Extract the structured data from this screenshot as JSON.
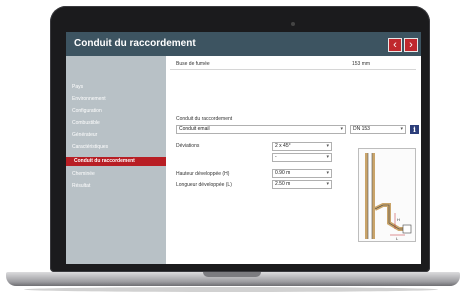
{
  "window": {
    "title": "Conduit du raccordement",
    "prev_label": "‹",
    "next_label": "›"
  },
  "sidebar": {
    "items": [
      {
        "label": "Pays"
      },
      {
        "label": "Environnement"
      },
      {
        "label": "Configuration"
      },
      {
        "label": "Combustible"
      },
      {
        "label": "Générateur"
      },
      {
        "label": "Caractéristiques"
      },
      {
        "label": "Conduit du raccordement",
        "active": true
      },
      {
        "label": "Cheminée"
      },
      {
        "label": "Résultat"
      }
    ]
  },
  "main": {
    "buse": {
      "label": "Buse de fumée",
      "value": "153 mm"
    },
    "conduit": {
      "section_label": "Conduit du raccordement",
      "type_value": "Conduit email",
      "size_value": "DN 153"
    },
    "deviations": {
      "label": "Déviations",
      "value1": "2 x 45°",
      "value2": "-"
    },
    "hauteur": {
      "label": "Hauteur développée (H)",
      "value": "0.90 m"
    },
    "longueur": {
      "label": "Longueur développée (L)",
      "value": "2.50 m"
    },
    "diagram": {
      "h_label": "H",
      "l_label": "L"
    }
  },
  "icons": {
    "info": "info-icon",
    "prev": "chevron-left-icon",
    "next": "chevron-right-icon"
  },
  "colors": {
    "titlebar": "#3d5461",
    "accent": "#b81e24",
    "sidebar": "#b8c1c6",
    "info": "#2c3e7a"
  }
}
